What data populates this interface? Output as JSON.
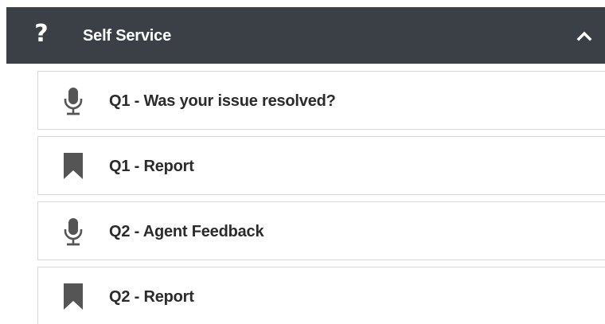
{
  "section": {
    "icon": "question-mark-icon",
    "title": "Self Service",
    "toggle_icon": "chevron-up-icon"
  },
  "items": [
    {
      "icon": "microphone-icon",
      "label": "Q1 - Was your issue resolved?"
    },
    {
      "icon": "bookmark-icon",
      "label": "Q1 - Report"
    },
    {
      "icon": "microphone-icon",
      "label": "Q2 - Agent Feedback"
    },
    {
      "icon": "bookmark-icon",
      "label": "Q2 - Report"
    }
  ],
  "colors": {
    "header_bg": "#3b4047",
    "header_text": "#ffffff",
    "icon": "#555555",
    "item_text": "#2b2b2b",
    "item_border": "#d6d6d6"
  }
}
